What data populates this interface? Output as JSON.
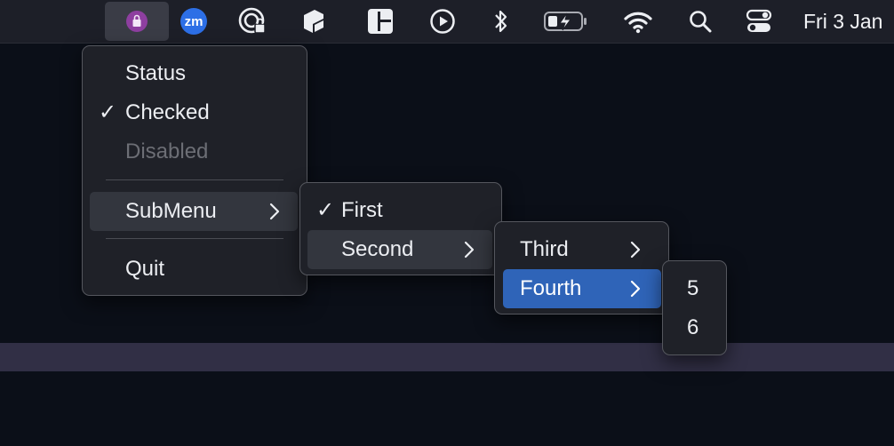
{
  "menubar": {
    "clock": "Fri 3 Jan",
    "icons": [
      "app-extra-icon",
      "zoom-icon",
      "privacy-lock-icon",
      "cube-icon",
      "window-layout-icon",
      "play-circle-icon",
      "bluetooth-icon",
      "battery-charging-icon",
      "wifi-icon",
      "search-icon",
      "control-center-icon"
    ],
    "zoom_label": "zm"
  },
  "main_menu": {
    "items": [
      {
        "label": "Status",
        "checked": false,
        "enabled": true
      },
      {
        "label": "Checked",
        "checked": true,
        "enabled": true
      },
      {
        "label": "Disabled",
        "checked": false,
        "enabled": false
      },
      {
        "label": "SubMenu",
        "submenu": true,
        "highlighted": true
      },
      {
        "label": "Quit"
      }
    ],
    "check_glyph": "✓"
  },
  "submenu_1": {
    "items": [
      {
        "label": "First",
        "checked": true
      },
      {
        "label": "Second",
        "submenu": true,
        "highlighted": true
      }
    ]
  },
  "submenu_2": {
    "items": [
      {
        "label": "Third",
        "submenu": true
      },
      {
        "label": "Fourth",
        "submenu": true,
        "selected": true
      }
    ]
  },
  "submenu_3": {
    "items": [
      {
        "label": "5"
      },
      {
        "label": "6"
      }
    ]
  },
  "colors": {
    "accent": "#2f64b8",
    "menubar": "#1d1f28",
    "menu_bg": "#1f2128",
    "desktop": "#0b0f18",
    "band": "#312f45"
  }
}
